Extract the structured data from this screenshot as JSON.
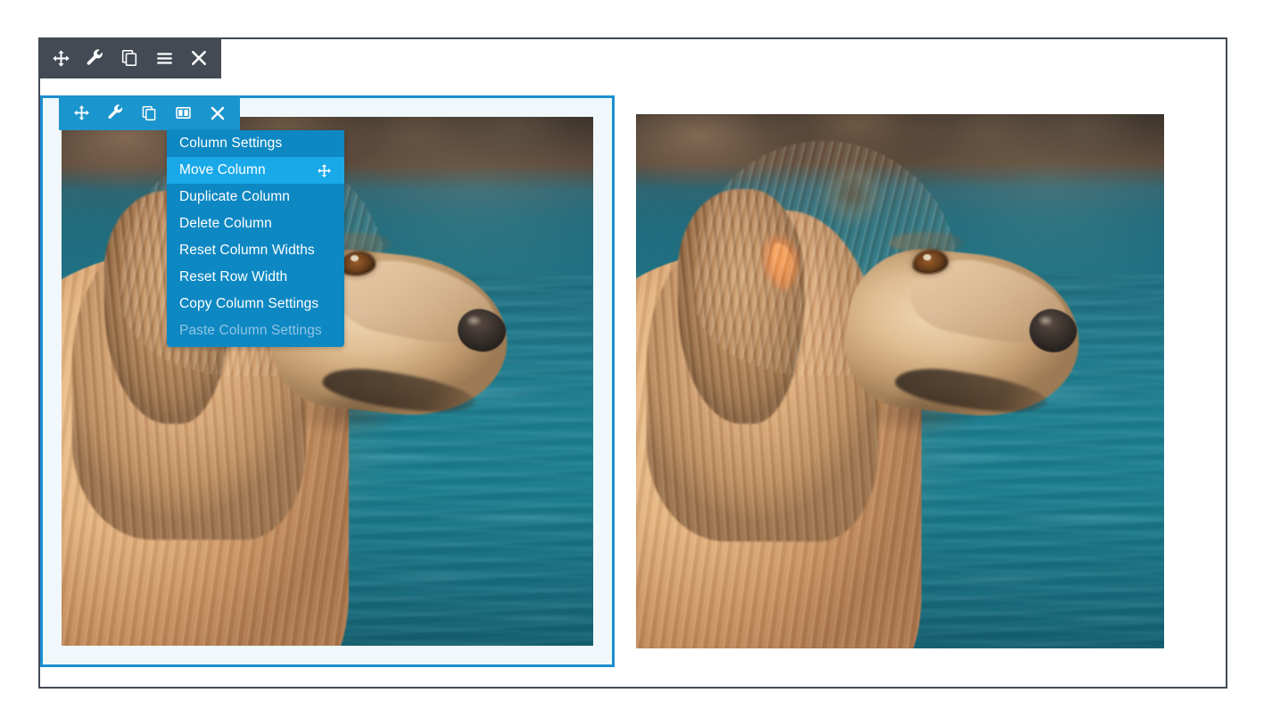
{
  "page": {
    "title": "Column Settings Context Menu",
    "background": "#ffffff"
  },
  "colors": {
    "module_border": "#434a54",
    "toolbar_dark_bg": "#434a54",
    "toolbar_blue_bg": "#1b95cd",
    "column_border": "#1b8fd0",
    "column_fill": "#f1f8fb",
    "menu_bg": "#0d88c3",
    "menu_active_bg": "#1aa9e8",
    "menu_text": "#ffffff",
    "menu_disabled_text": "#8fc5e2",
    "icon_color": "#ffffff"
  },
  "module_toolbar": {
    "name": "row-module-toolbar",
    "buttons": [
      {
        "name": "move-module-button",
        "icon": "move-arrows-icon",
        "label": "Move"
      },
      {
        "name": "module-settings-button",
        "icon": "wrench-icon",
        "label": "Settings"
      },
      {
        "name": "duplicate-module-button",
        "icon": "duplicate-icon",
        "label": "Duplicate"
      },
      {
        "name": "module-menu-button",
        "icon": "hamburger-icon",
        "label": "Menu"
      },
      {
        "name": "delete-module-button",
        "icon": "close-x-icon",
        "label": "Delete"
      }
    ]
  },
  "column_toolbar": {
    "name": "column-toolbar",
    "buttons": [
      {
        "name": "move-column-button",
        "icon": "move-arrows-icon",
        "label": "Move Column"
      },
      {
        "name": "column-settings-button",
        "icon": "wrench-icon",
        "label": "Column Settings"
      },
      {
        "name": "duplicate-column-button",
        "icon": "duplicate-icon",
        "label": "Duplicate Column"
      },
      {
        "name": "column-layout-button",
        "icon": "two-columns-icon",
        "label": "Column Layout"
      },
      {
        "name": "delete-column-button",
        "icon": "close-x-icon",
        "label": "Delete Column"
      }
    ]
  },
  "context_menu": {
    "name": "column-context-menu",
    "items": [
      {
        "label": "Column Settings",
        "state": "normal",
        "icon": null
      },
      {
        "label": "Move Column",
        "state": "active",
        "icon": "move-arrows-icon"
      },
      {
        "label": "Duplicate Column",
        "state": "normal",
        "icon": null
      },
      {
        "label": "Delete Column",
        "state": "normal",
        "icon": null
      },
      {
        "label": "Reset Column Widths",
        "state": "normal",
        "icon": null
      },
      {
        "label": "Reset Row Width",
        "state": "normal",
        "icon": null
      },
      {
        "label": "Copy Column Settings",
        "state": "normal",
        "icon": null
      },
      {
        "label": "Paste Column Settings",
        "state": "disabled",
        "icon": null
      }
    ]
  },
  "columns": [
    {
      "name": "column-left",
      "selected": true,
      "image": {
        "name": "golden-retriever-photo-left",
        "alt": "Golden retriever dog in profile facing right, teal water and dark rocky shoreline behind"
      }
    },
    {
      "name": "column-right",
      "selected": false,
      "image": {
        "name": "golden-retriever-photo-right",
        "alt": "Golden retriever dog in profile facing right, teal water and dark rocky shoreline behind"
      }
    }
  ]
}
